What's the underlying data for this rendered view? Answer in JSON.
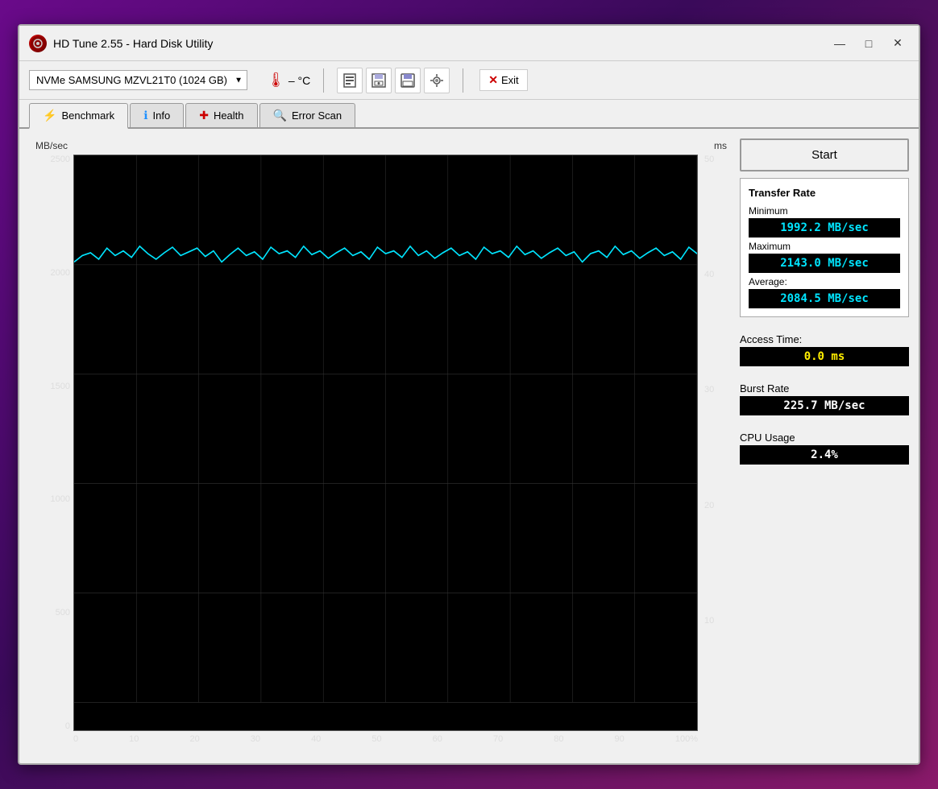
{
  "window": {
    "title": "HD Tune 2.55  -  Hard Disk Utility",
    "app_icon": "HD"
  },
  "window_controls": {
    "minimize": "—",
    "maximize": "□",
    "close": "✕"
  },
  "toolbar": {
    "disk_name": "NVMe   SAMSUNG MZVL21T0 (1024 GB)",
    "temp_label": "– °C",
    "exit_label": "Exit"
  },
  "tabs": [
    {
      "label": "Benchmark",
      "icon": "⚡",
      "active": true
    },
    {
      "label": "Info",
      "icon": "ℹ",
      "active": false
    },
    {
      "label": "Health",
      "icon": "➕",
      "active": false
    },
    {
      "label": "Error Scan",
      "icon": "🔍",
      "active": false
    }
  ],
  "chart": {
    "y_axis_title": "MB/sec",
    "y_axis_title_right": "ms",
    "y_labels_left": [
      "2500",
      "2000",
      "1500",
      "1000",
      "500",
      "0"
    ],
    "y_labels_right": [
      "50",
      "40",
      "30",
      "20",
      "10",
      ""
    ],
    "x_labels": [
      "0",
      "10",
      "20",
      "30",
      "40",
      "50",
      "60",
      "70",
      "80",
      "90",
      "100%"
    ]
  },
  "stats": {
    "transfer_rate_title": "Transfer Rate",
    "minimum_label": "Minimum",
    "minimum_value": "1992.2 MB/sec",
    "maximum_label": "Maximum",
    "maximum_value": "2143.0 MB/sec",
    "average_label": "Average:",
    "average_value": "2084.5 MB/sec",
    "access_time_label": "Access Time:",
    "access_time_value": "0.0 ms",
    "burst_rate_label": "Burst Rate",
    "burst_rate_value": "225.7 MB/sec",
    "cpu_usage_label": "CPU Usage",
    "cpu_usage_value": "2.4%",
    "start_button": "Start"
  }
}
